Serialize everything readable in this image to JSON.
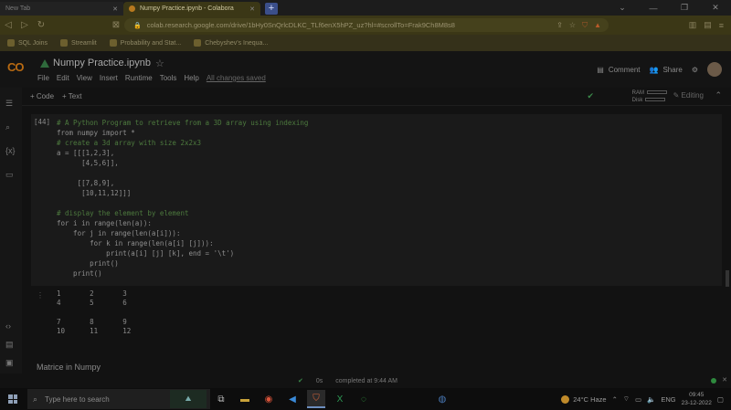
{
  "browser": {
    "tabs": [
      {
        "label": "New Tab",
        "active": false
      },
      {
        "label": "Numpy Practice.ipynb - Colabora",
        "active": true
      }
    ],
    "new_tab_label": "+",
    "url": "colab.research.google.com/drive/1bHy0SnQrlcDLKC_TLf6enX5hPZ_uz?hl=#scrollTo=Frak9Ch8M8s8",
    "bookmarks": [
      "SQL Joins",
      "Streamlit",
      "Probability and Stat...",
      "Chebyshev's Inequa..."
    ]
  },
  "colab": {
    "logo": "CO",
    "notebook_title": "Numpy Practice.ipynb",
    "menu": [
      "File",
      "Edit",
      "View",
      "Insert",
      "Runtime",
      "Tools",
      "Help"
    ],
    "save_status": "All changes saved",
    "comment_label": "Comment",
    "share_label": "Share",
    "toolbar": {
      "code_label": "+ Code",
      "text_label": "+ Text",
      "ram_label": "RAM",
      "disk_label": "Disk",
      "editing_label": "Editing"
    },
    "cell": {
      "exec_count": "[44]",
      "lines": [
        "# A Python Program to retrieve from a 3D array using indexing",
        "from numpy import *",
        "# create a 3d array with size 2x2x3",
        "a = [[[1,2,3],",
        "      [4,5,6]],",
        "",
        "     [[7,8,9],",
        "      [10,11,12]]]",
        "",
        "# display the element by element",
        "for i in range(len(a)):",
        "    for j in range(len(a[i])):",
        "        for k in range(len(a[i] [j])):",
        "            print(a[i] [j] [k], end = '\\t')",
        "        print()",
        "    print()"
      ]
    },
    "output_lines": [
      "1       2       3",
      "4       5       6",
      "",
      "7       8       9",
      "10      11      12"
    ],
    "next_section": "Matrice in Numpy",
    "status": {
      "time": "0s",
      "message": "completed at 9:44 AM"
    }
  },
  "taskbar": {
    "search_placeholder": "Type here to search",
    "weather": "24°C  Haze",
    "language": "ENG",
    "time": "09:45",
    "date": "23-12-2022"
  }
}
